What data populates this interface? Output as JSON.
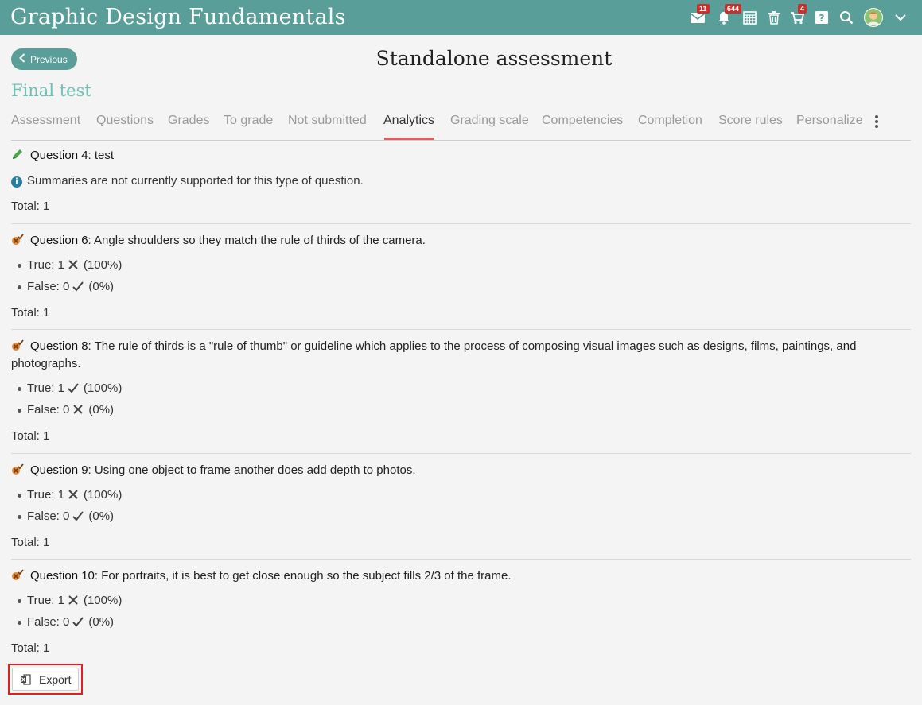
{
  "app": {
    "title": "Graphic Design Fundamentals"
  },
  "toolbar": {
    "messages_badge": "11",
    "notifications_badge": "644",
    "cart_badge": "4",
    "accent_color": "#5a9e99",
    "icons": [
      "envelope-icon",
      "bell-icon",
      "calendar-icon",
      "trash-icon",
      "cart-icon",
      "help-icon",
      "search-icon",
      "avatar",
      "chevron-down-icon"
    ]
  },
  "header": {
    "previous_label": "Previous",
    "page_title": "Standalone assessment",
    "section_title": "Final test"
  },
  "tabs": [
    {
      "label": "Assessment"
    },
    {
      "label": "Questions"
    },
    {
      "label": "Grades"
    },
    {
      "label": "To grade"
    },
    {
      "label": "Not submitted"
    },
    {
      "label": "Analytics",
      "active": true
    },
    {
      "label": "Grading scale"
    },
    {
      "label": "Competencies"
    },
    {
      "label": "Completion"
    },
    {
      "label": "Score rules"
    },
    {
      "label": "Personalize"
    }
  ],
  "questions": [
    {
      "number": "Question 4",
      "text": ": test",
      "info": "Summaries are not currently supported for this type of question.",
      "total": "Total: 1"
    },
    {
      "number": "Question 6",
      "text": ": Angle shoulders so they match the rule of thirds of the camera.",
      "answers": [
        {
          "label": "True: 1",
          "correct": false,
          "pct": "(100%)"
        },
        {
          "label": "False: 0",
          "correct": true,
          "pct": "(0%)"
        }
      ],
      "total": "Total: 1"
    },
    {
      "number": "Question 8",
      "text": ": The rule of thirds is a \"rule of thumb\" or guideline which applies to the process of composing visual images such as designs, films, paintings, and photographs.",
      "answers": [
        {
          "label": "True: 1",
          "correct": true,
          "pct": "(100%)"
        },
        {
          "label": "False: 0",
          "correct": false,
          "pct": "(0%)"
        }
      ],
      "total": "Total: 1"
    },
    {
      "number": "Question 9",
      "text": ": Using one object to frame another does add depth to photos.",
      "answers": [
        {
          "label": "True: 1",
          "correct": false,
          "pct": "(100%)"
        },
        {
          "label": "False: 0",
          "correct": true,
          "pct": "(0%)"
        }
      ],
      "total": "Total: 1"
    },
    {
      "number": "Question 10",
      "text": ": For portraits, it is best to get close enough so the subject fills 2/3 of the frame.",
      "answers": [
        {
          "label": "True: 1",
          "correct": false,
          "pct": "(100%)"
        },
        {
          "label": "False: 0",
          "correct": true,
          "pct": "(0%)"
        }
      ],
      "total": "Total: 1"
    }
  ],
  "export": {
    "label": "Export"
  }
}
